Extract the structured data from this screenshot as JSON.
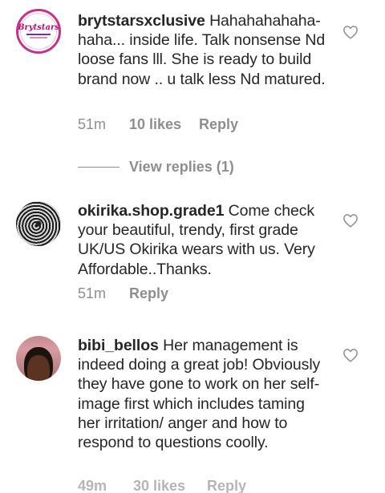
{
  "comments": [
    {
      "username": "brytstarsxclusive",
      "text": "Hahahahahaha-haha... inside life. Talk nonsense Nd loose fans lll. She is ready to build brand now .. u talk less Nd matured.",
      "time": "51m",
      "likes": "10 likes",
      "reply": "Reply",
      "avatar_text": "Brytstars",
      "liked": false
    },
    {
      "username": "okirika.shop.grade1",
      "text": "Come check your beautiful, trendy, first  grade UK/US Okirika wears with us. Very Affordable..Thanks.",
      "time": "51m",
      "reply": "Reply",
      "liked": false
    },
    {
      "username": "bibi_bellos",
      "text": "Her management is indeed doing a great job! Obviously they have gone to work on her self-image first which includes taming her irritation/ anger and how to respond to questions coolly.",
      "time": "49m",
      "likes": "30 likes",
      "reply": "Reply",
      "liked": false
    }
  ],
  "view_replies": "View replies (1)",
  "colors": {
    "text": "#262626",
    "meta": "#8e8e8e",
    "brand_ring": "#c13584"
  },
  "icons": {
    "like": "heart-outline-icon"
  }
}
